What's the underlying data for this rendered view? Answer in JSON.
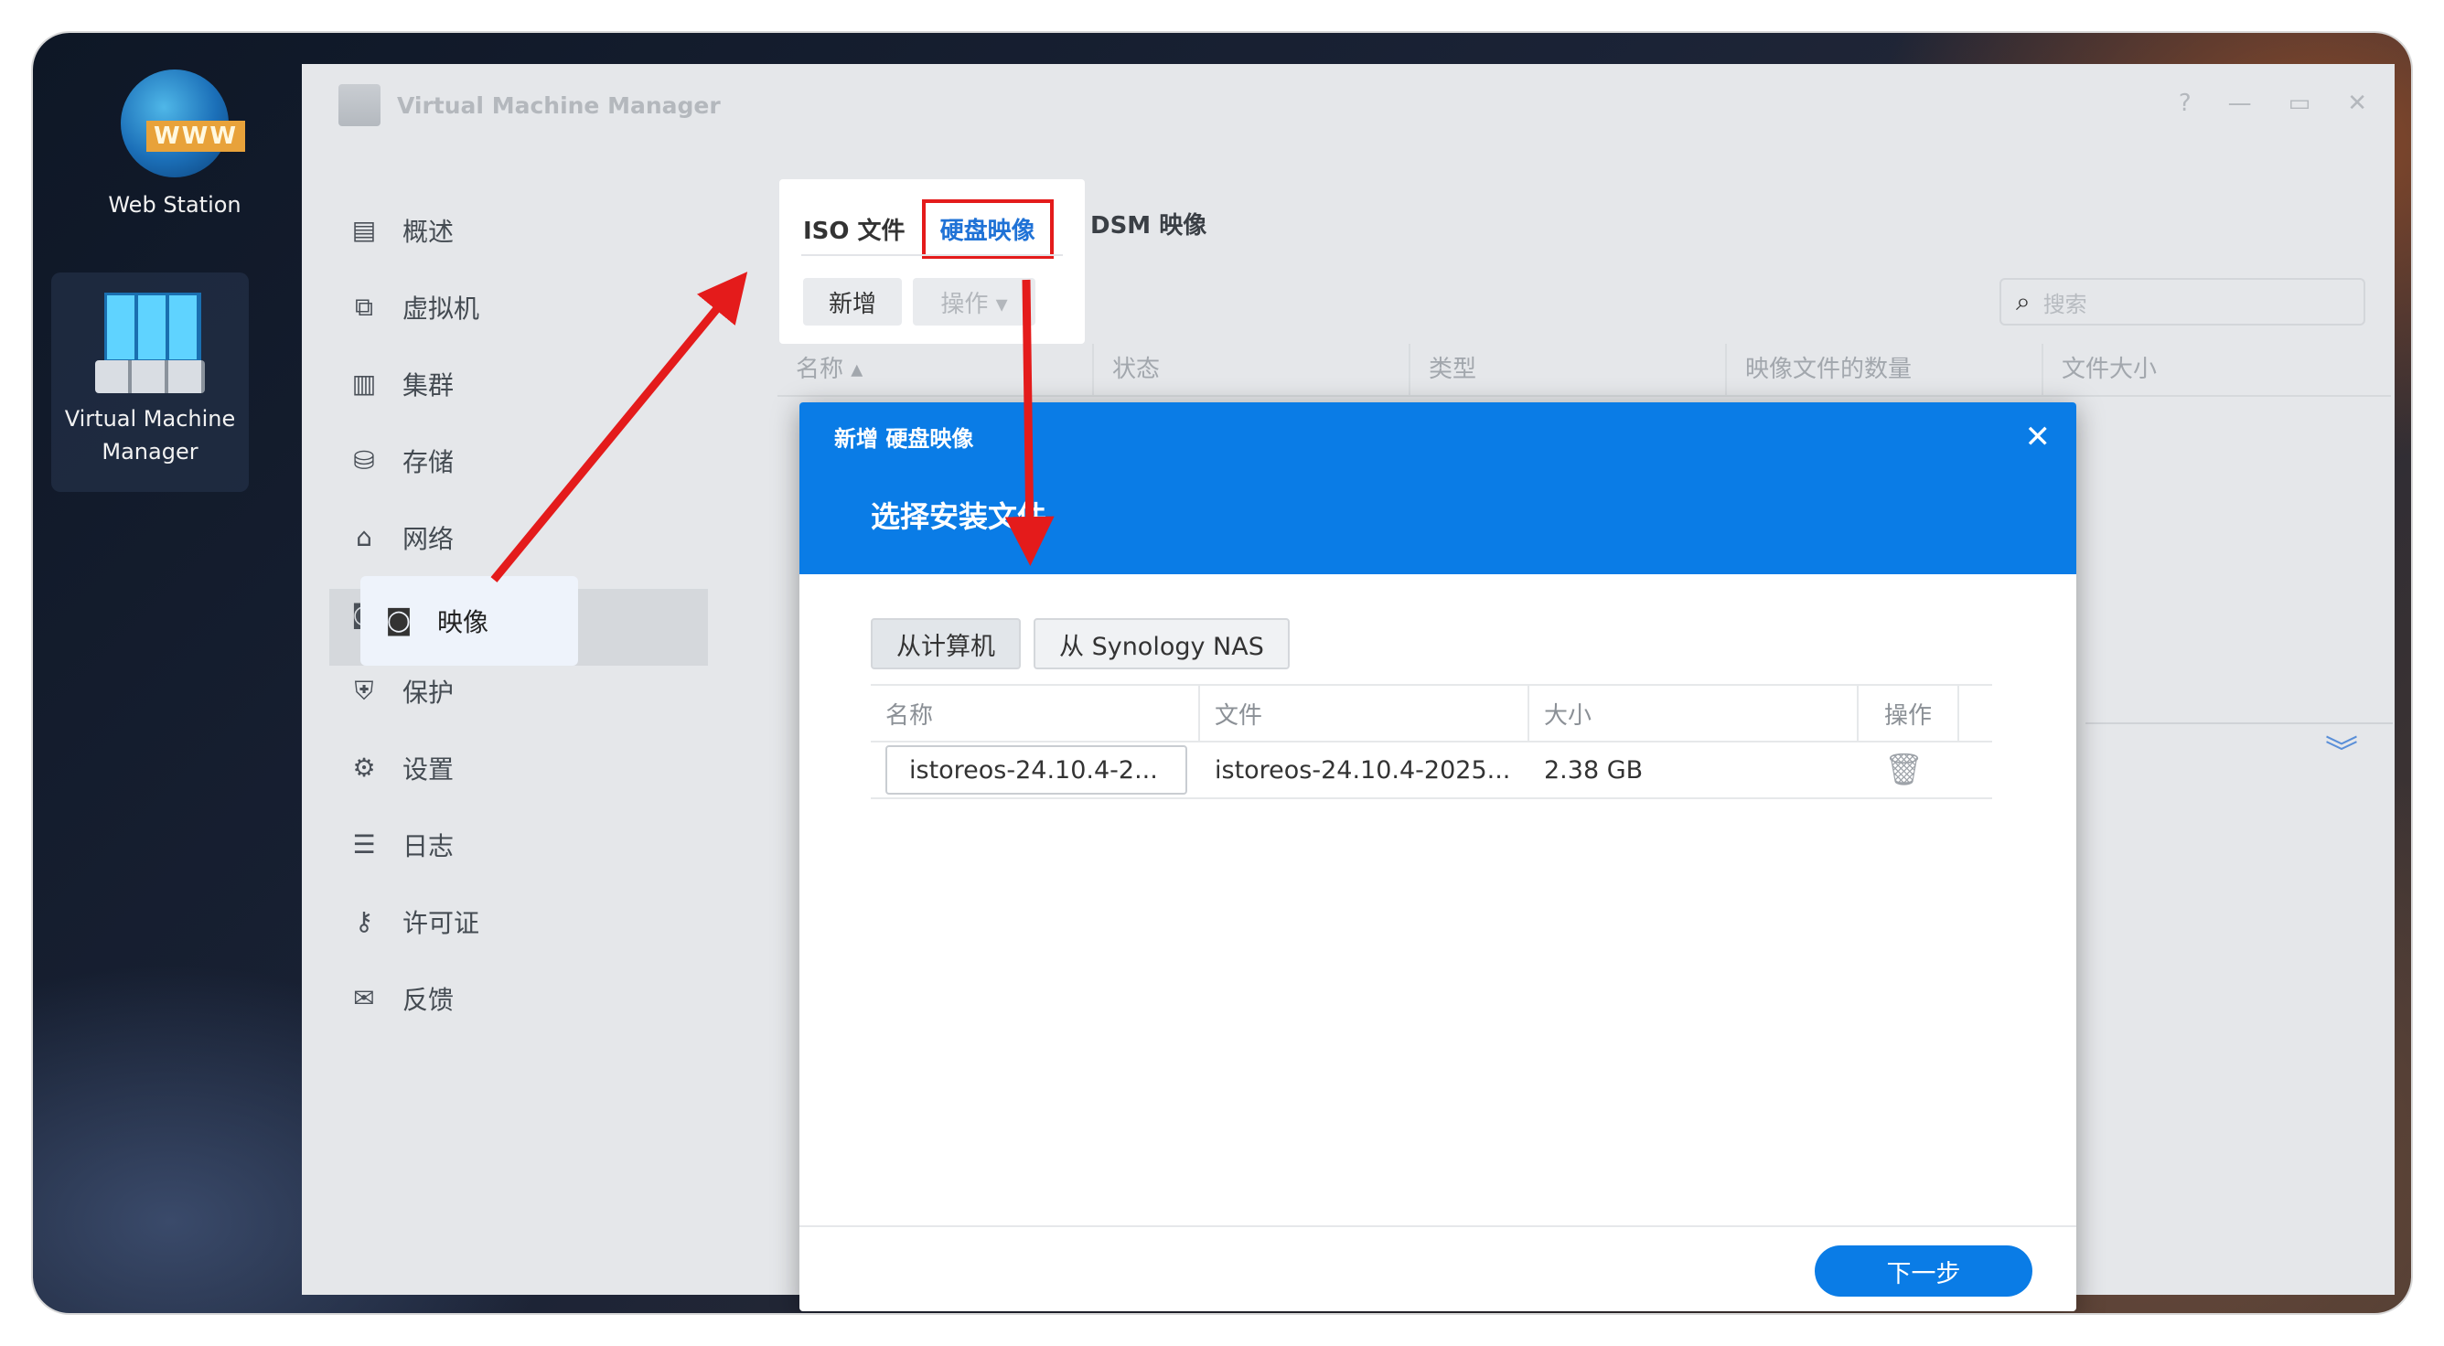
{
  "desktop": {
    "web_station_label": "Web Station",
    "web_station_icon_text": "WWW",
    "vmm_label_line1": "Virtual Machine",
    "vmm_label_line2": "Manager"
  },
  "window": {
    "title": "Virtual Machine Manager",
    "controls": [
      "?",
      "—",
      "▭",
      "✕"
    ]
  },
  "sidebar": {
    "items": [
      {
        "label": "概述",
        "icon": "overview-icon"
      },
      {
        "label": "虚拟机",
        "icon": "vm-icon"
      },
      {
        "label": "集群",
        "icon": "cluster-icon"
      },
      {
        "label": "存储",
        "icon": "storage-icon"
      },
      {
        "label": "网络",
        "icon": "network-icon"
      },
      {
        "label": "映像",
        "icon": "image-icon"
      },
      {
        "label": "保护",
        "icon": "shield-icon"
      },
      {
        "label": "设置",
        "icon": "gear-icon"
      },
      {
        "label": "日志",
        "icon": "log-icon"
      },
      {
        "label": "许可证",
        "icon": "key-icon"
      },
      {
        "label": "反馈",
        "icon": "mail-icon"
      }
    ]
  },
  "image_tabs": {
    "iso": "ISO 文件",
    "disk": "硬盘映像",
    "dsm": "DSM 映像"
  },
  "toolbar": {
    "add_label": "新增",
    "action_label": "操作 ▾"
  },
  "search": {
    "placeholder": "搜索"
  },
  "table": {
    "columns": [
      "名称 ▴",
      "状态",
      "类型",
      "映像文件的数量",
      "文件大小"
    ]
  },
  "modal": {
    "header": "新增 硬盘映像",
    "title": "选择安装文件",
    "source_buttons": [
      "从计算机",
      "从 Synology NAS"
    ],
    "columns": [
      "名称",
      "文件",
      "大小",
      "操作"
    ],
    "rows": [
      {
        "name": "istoreos-24.10.4-2...",
        "file": "istoreos-24.10.4-2025...",
        "size": "2.38 GB"
      }
    ],
    "next_label": "下一步"
  },
  "colors": {
    "accent_blue": "#0a7ce6",
    "annotation_red": "#e41b1b"
  }
}
